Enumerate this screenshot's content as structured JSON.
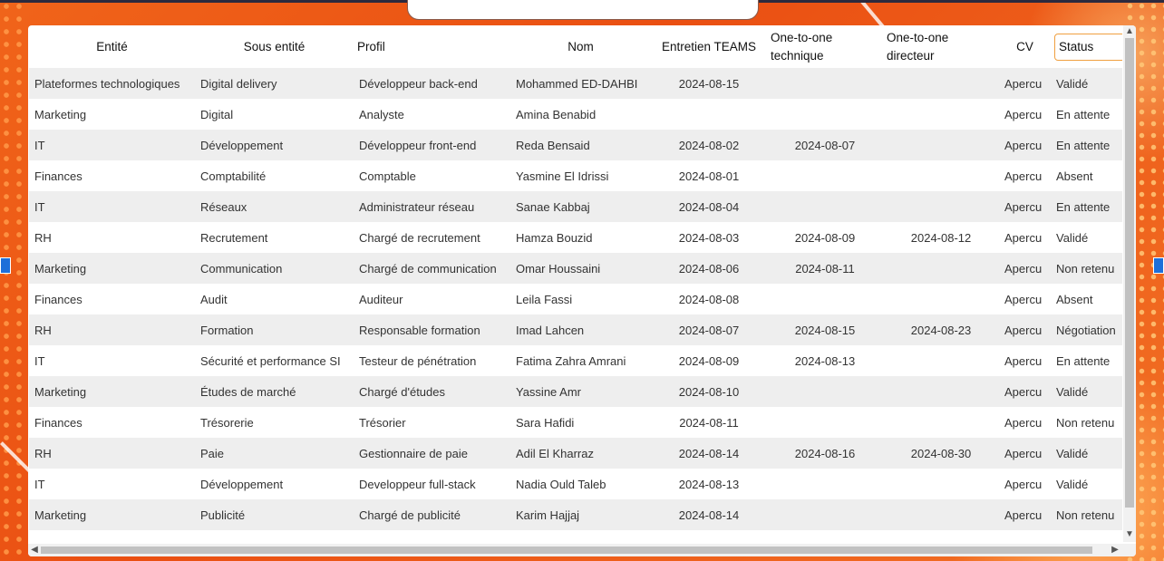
{
  "table": {
    "headers": [
      "Entité",
      "Sous entité",
      "Profil",
      "Nom",
      "Entretien TEAMS",
      "One-to-one technique",
      "One-to-one directeur",
      "CV",
      "Status"
    ],
    "rows": [
      [
        "Plateformes technologiques",
        "Digital delivery",
        "Développeur back-end",
        "Mohammed ED-DAHBI",
        "2024-08-15",
        "",
        "",
        "Apercu",
        "Validé"
      ],
      [
        "Marketing",
        "Digital",
        "Analyste",
        "Amina Benabid",
        "",
        "",
        "",
        "Apercu",
        "En attente"
      ],
      [
        "IT",
        "Développement",
        "Développeur front-end",
        "Reda Bensaid",
        "2024-08-02",
        "2024-08-07",
        "",
        "Apercu",
        "En attente"
      ],
      [
        "Finances",
        "Comptabilité",
        "Comptable",
        "Yasmine El Idrissi",
        "2024-08-01",
        "",
        "",
        "Apercu",
        "Absent"
      ],
      [
        "IT",
        "Réseaux",
        "Administrateur réseau",
        "Sanae Kabbaj",
        "2024-08-04",
        "",
        "",
        "Apercu",
        "En attente"
      ],
      [
        "RH",
        "Recrutement",
        "Chargé de recrutement",
        "Hamza Bouzid",
        "2024-08-03",
        "2024-08-09",
        "2024-08-12",
        "Apercu",
        "Validé"
      ],
      [
        "Marketing",
        "Communication",
        "Chargé de communication",
        "Omar Houssaini",
        "2024-08-06",
        "2024-08-11",
        "",
        "Apercu",
        "Non retenu"
      ],
      [
        "Finances",
        "Audit",
        "Auditeur",
        "Leila Fassi",
        "2024-08-08",
        "",
        "",
        "Apercu",
        "Absent"
      ],
      [
        "RH",
        "Formation",
        "Responsable formation",
        "Imad Lahcen",
        "2024-08-07",
        "2024-08-15",
        "2024-08-23",
        "Apercu",
        "Négotiation"
      ],
      [
        "IT",
        "Sécurité et performance SI",
        "Testeur de pénétration",
        "Fatima Zahra Amrani",
        "2024-08-09",
        "2024-08-13",
        "",
        "Apercu",
        "En attente"
      ],
      [
        "Marketing",
        "Études de marché",
        "Chargé d'études",
        "Yassine Amr",
        "2024-08-10",
        "",
        "",
        "Apercu",
        "Validé"
      ],
      [
        "Finances",
        "Trésorerie",
        "Trésorier",
        "Sara Hafidi",
        "2024-08-11",
        "",
        "",
        "Apercu",
        "Non retenu"
      ],
      [
        "RH",
        "Paie",
        "Gestionnaire de paie",
        "Adil El Kharraz",
        "2024-08-14",
        "2024-08-16",
        "2024-08-30",
        "Apercu",
        "Validé"
      ],
      [
        "IT",
        "Développement",
        "Developpeur full-stack",
        "Nadia Ould Taleb",
        "2024-08-13",
        "",
        "",
        "Apercu",
        "Validé"
      ],
      [
        "Marketing",
        "Publicité",
        "Chargé de publicité",
        "Karim Hajjaj",
        "2024-08-14",
        "",
        "",
        "Apercu",
        "Non retenu"
      ]
    ]
  },
  "scroll": {
    "up": "▲",
    "down": "▼",
    "left": "◀",
    "right": "▶"
  }
}
